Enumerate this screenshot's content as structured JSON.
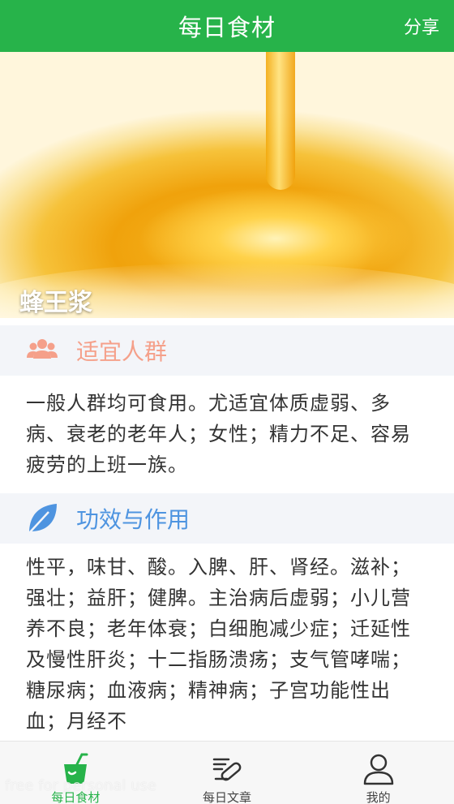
{
  "app_bar": {
    "title": "每日食材",
    "share_label": "分享"
  },
  "hero": {
    "food_name": "蜂王浆"
  },
  "sections": [
    {
      "title": "适宜人群",
      "icon": "people-icon",
      "color": "#f5a08a",
      "body": "一般人群均可食用。尤适宜体质虚弱、多病、衰老的老年人；女性；精力不足、容易疲劳的上班一族。"
    },
    {
      "title": "功效与作用",
      "icon": "leaf-icon",
      "color": "#4e94e0",
      "body": "性平，味甘、酸。入脾、肝、肾经。滋补；强壮；益肝；健脾。主治病后虚弱；小儿营养不良；老年体衰；白细胞减少症；迁延性及慢性肝炎；十二指肠溃疡；支气管哮喘；糖尿病；血液病；精神病；子宫功能性出血；月经不"
    }
  ],
  "tab_bar": {
    "tabs": [
      {
        "label": "每日食材",
        "icon": "cup-icon",
        "active": true
      },
      {
        "label": "每日文章",
        "icon": "article-icon",
        "active": false
      },
      {
        "label": "我的",
        "icon": "user-icon",
        "active": false
      }
    ]
  },
  "watermark": "free for personal use",
  "colors": {
    "primary": "#27b34a",
    "section_bg": "#f3f5f9"
  }
}
